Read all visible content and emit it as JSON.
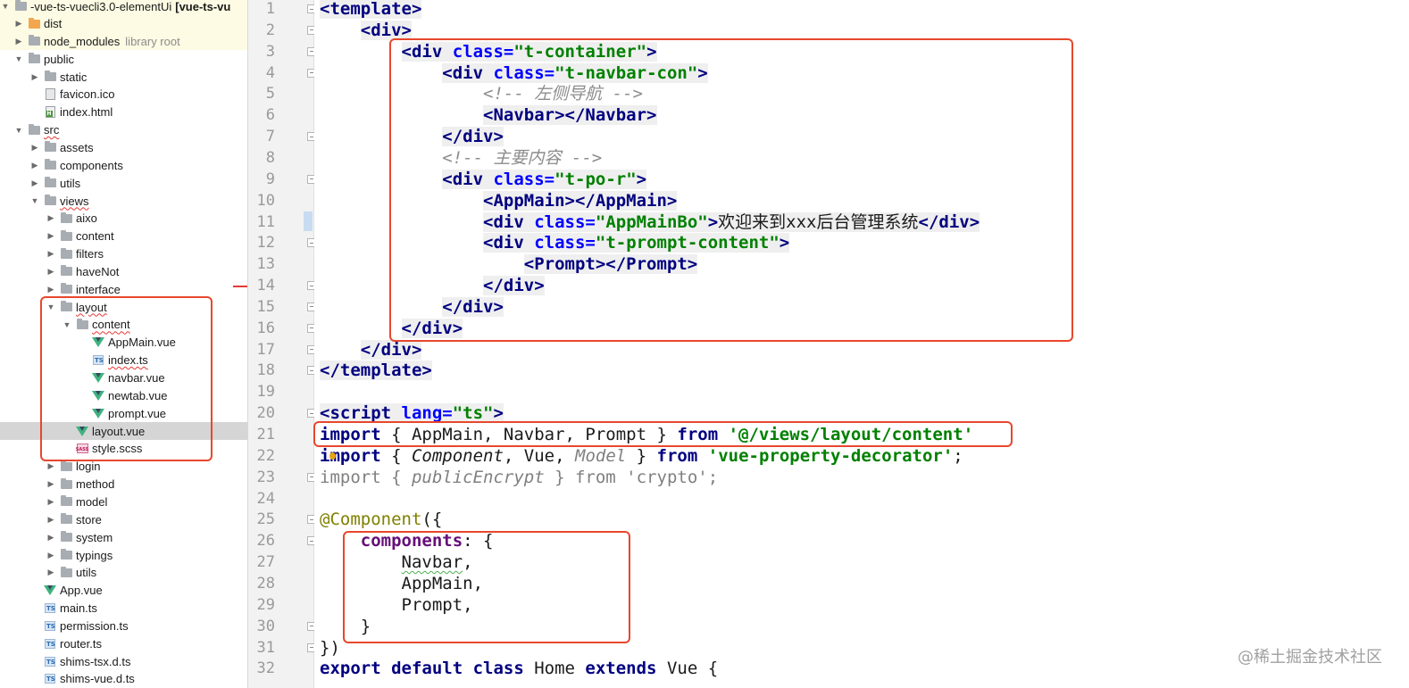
{
  "project": {
    "title": "-vue-ts-vuecli3.0-elementUi",
    "title_module": "[vue-ts-vu"
  },
  "tree": [
    {
      "label": "dist",
      "indent": 1,
      "arrow": "right",
      "icon": "folder-orange"
    },
    {
      "label": "node_modules",
      "extra": "library root",
      "indent": 1,
      "arrow": "right",
      "icon": "folder"
    },
    {
      "label": "public",
      "indent": 1,
      "arrow": "down",
      "icon": "folder"
    },
    {
      "label": "static",
      "indent": 2,
      "arrow": "right",
      "icon": "folder"
    },
    {
      "label": "favicon.ico",
      "indent": 2,
      "arrow": "",
      "icon": "ico"
    },
    {
      "label": "index.html",
      "indent": 2,
      "arrow": "",
      "icon": "html"
    },
    {
      "label": "src",
      "indent": 1,
      "arrow": "down",
      "icon": "folder",
      "wavy": true
    },
    {
      "label": "assets",
      "indent": 2,
      "arrow": "right",
      "icon": "folder"
    },
    {
      "label": "components",
      "indent": 2,
      "arrow": "right",
      "icon": "folder"
    },
    {
      "label": "utils",
      "indent": 2,
      "arrow": "right",
      "icon": "folder"
    },
    {
      "label": "views",
      "indent": 2,
      "arrow": "down",
      "icon": "folder",
      "wavy": true
    },
    {
      "label": "aixo",
      "indent": 3,
      "arrow": "right",
      "icon": "folder"
    },
    {
      "label": "content",
      "indent": 3,
      "arrow": "right",
      "icon": "folder"
    },
    {
      "label": "filters",
      "indent": 3,
      "arrow": "right",
      "icon": "folder"
    },
    {
      "label": "haveNot",
      "indent": 3,
      "arrow": "right",
      "icon": "folder"
    },
    {
      "label": "interface",
      "indent": 3,
      "arrow": "right",
      "icon": "folder"
    },
    {
      "label": "layout",
      "indent": 3,
      "arrow": "down",
      "icon": "folder",
      "wavy": true
    },
    {
      "label": "content",
      "indent": 4,
      "arrow": "down",
      "icon": "folder",
      "wavy": true
    },
    {
      "label": "AppMain.vue",
      "indent": 5,
      "arrow": "",
      "icon": "vue"
    },
    {
      "label": "index.ts",
      "indent": 5,
      "arrow": "",
      "icon": "ts",
      "wavy": true
    },
    {
      "label": "navbar.vue",
      "indent": 5,
      "arrow": "",
      "icon": "vue"
    },
    {
      "label": "newtab.vue",
      "indent": 5,
      "arrow": "",
      "icon": "vue"
    },
    {
      "label": "prompt.vue",
      "indent": 5,
      "arrow": "",
      "icon": "vue"
    },
    {
      "label": "layout.vue",
      "indent": 4,
      "arrow": "",
      "icon": "vue",
      "selected": true
    },
    {
      "label": "style.scss",
      "indent": 4,
      "arrow": "",
      "icon": "sass"
    },
    {
      "label": "login",
      "indent": 3,
      "arrow": "right",
      "icon": "folder"
    },
    {
      "label": "method",
      "indent": 3,
      "arrow": "right",
      "icon": "folder"
    },
    {
      "label": "model",
      "indent": 3,
      "arrow": "right",
      "icon": "folder"
    },
    {
      "label": "store",
      "indent": 3,
      "arrow": "right",
      "icon": "folder"
    },
    {
      "label": "system",
      "indent": 3,
      "arrow": "right",
      "icon": "folder"
    },
    {
      "label": "typings",
      "indent": 3,
      "arrow": "right",
      "icon": "folder"
    },
    {
      "label": "utils",
      "indent": 3,
      "arrow": "right",
      "icon": "folder"
    },
    {
      "label": "App.vue",
      "indent": 2,
      "arrow": "",
      "icon": "vue"
    },
    {
      "label": "main.ts",
      "indent": 2,
      "arrow": "",
      "icon": "ts"
    },
    {
      "label": "permission.ts",
      "indent": 2,
      "arrow": "",
      "icon": "ts"
    },
    {
      "label": "router.ts",
      "indent": 2,
      "arrow": "",
      "icon": "ts"
    },
    {
      "label": "shims-tsx.d.ts",
      "indent": 2,
      "arrow": "",
      "icon": "ts"
    },
    {
      "label": "shims-vue.d.ts",
      "indent": 2,
      "arrow": "",
      "icon": "ts"
    }
  ],
  "line_numbers": [
    "1",
    "2",
    "3",
    "4",
    "5",
    "6",
    "7",
    "8",
    "9",
    "10",
    "11",
    "12",
    "13",
    "14",
    "15",
    "16",
    "17",
    "18",
    "19",
    "20",
    "21",
    "22",
    "23",
    "24",
    "25",
    "26",
    "27",
    "28",
    "29",
    "30",
    "31",
    "32"
  ],
  "code": [
    [
      [
        "<template>",
        "tg tagbg"
      ]
    ],
    [
      [
        "    ",
        ""
      ],
      [
        "<div>",
        "tg tagbg"
      ]
    ],
    [
      [
        "        ",
        ""
      ],
      [
        "<div ",
        "tg tagbg"
      ],
      [
        "class=",
        "at tagbg"
      ],
      [
        "\"t-container\"",
        "sv tagbg"
      ],
      [
        ">",
        "tg tagbg"
      ]
    ],
    [
      [
        "            ",
        ""
      ],
      [
        "<div ",
        "tg tagbg"
      ],
      [
        "class=",
        "at tagbg"
      ],
      [
        "\"t-navbar-con\"",
        "sv tagbg"
      ],
      [
        ">",
        "tg tagbg"
      ]
    ],
    [
      [
        "                ",
        ""
      ],
      [
        "<!-- 左侧导航 -->",
        "cm"
      ]
    ],
    [
      [
        "                ",
        ""
      ],
      [
        "<Navbar></Navbar>",
        "tg tagbg"
      ]
    ],
    [
      [
        "            ",
        ""
      ],
      [
        "</div>",
        "tg tagbg"
      ]
    ],
    [
      [
        "            ",
        ""
      ],
      [
        "<!-- 主要内容 -->",
        "cm"
      ]
    ],
    [
      [
        "            ",
        ""
      ],
      [
        "<div ",
        "tg tagbg"
      ],
      [
        "class=",
        "at tagbg"
      ],
      [
        "\"t-po-r\"",
        "sv tagbg"
      ],
      [
        ">",
        "tg tagbg"
      ]
    ],
    [
      [
        "                ",
        ""
      ],
      [
        "<AppMain></AppMain>",
        "tg tagbg"
      ]
    ],
    [
      [
        "                ",
        ""
      ],
      [
        "<div ",
        "tg tagbg"
      ],
      [
        "class=",
        "at tagbg"
      ],
      [
        "\"AppMainBo\"",
        "sv tagbg"
      ],
      [
        ">",
        "tg tagbg"
      ],
      [
        "欢迎来到xxx后台管理系统",
        "tagbg"
      ],
      [
        "</div>",
        "tg tagbg"
      ]
    ],
    [
      [
        "                ",
        ""
      ],
      [
        "<div ",
        "tg tagbg"
      ],
      [
        "class=",
        "at tagbg"
      ],
      [
        "\"t-prompt-content\"",
        "sv tagbg"
      ],
      [
        ">",
        "tg tagbg"
      ]
    ],
    [
      [
        "                    ",
        ""
      ],
      [
        "<Prompt></Prompt>",
        "tg tagbg"
      ]
    ],
    [
      [
        "                ",
        ""
      ],
      [
        "</div>",
        "tg tagbg"
      ]
    ],
    [
      [
        "            ",
        ""
      ],
      [
        "</div>",
        "tg tagbg"
      ]
    ],
    [
      [
        "        ",
        ""
      ],
      [
        "</div>",
        "tg tagbg"
      ]
    ],
    [
      [
        "    ",
        ""
      ],
      [
        "</div>",
        "tg tagbg"
      ]
    ],
    [
      [
        "</template>",
        "tg tagbg"
      ]
    ],
    [
      [
        "",
        ""
      ]
    ],
    [
      [
        "<script ",
        "tg tagbg"
      ],
      [
        "lang=",
        "at tagbg"
      ],
      [
        "\"ts\"",
        "sv tagbg"
      ],
      [
        ">",
        "tg tagbg"
      ]
    ],
    [
      [
        "import",
        "kw"
      ],
      [
        " { AppMain, Navbar, Prompt } ",
        ""
      ],
      [
        "from",
        "kw"
      ],
      [
        " ",
        ""
      ],
      [
        "'@/views/layout/content'",
        "sv"
      ]
    ],
    [
      [
        "import",
        "kw"
      ],
      [
        " { ",
        ""
      ],
      [
        "Component",
        "it"
      ],
      [
        ", Vue, ",
        ""
      ],
      [
        "Model",
        "it gr"
      ],
      [
        " } ",
        ""
      ],
      [
        "from",
        "kw"
      ],
      [
        " ",
        ""
      ],
      [
        "'vue-property-decorator'",
        "sv"
      ],
      [
        ";",
        ""
      ]
    ],
    [
      [
        "import { ",
        "gr"
      ],
      [
        "publicEncrypt",
        "gr it"
      ],
      [
        " } from 'crypto';",
        "gr"
      ]
    ],
    [
      [
        "",
        ""
      ]
    ],
    [
      [
        "@Component",
        "an"
      ],
      [
        "({",
        ""
      ]
    ],
    [
      [
        "    ",
        ""
      ],
      [
        "components",
        "pp"
      ],
      [
        ": {",
        ""
      ]
    ],
    [
      [
        "        ",
        ""
      ],
      [
        "Navbar",
        "wv"
      ],
      [
        ",",
        ""
      ]
    ],
    [
      [
        "        AppMain,",
        ""
      ]
    ],
    [
      [
        "        Prompt,",
        ""
      ]
    ],
    [
      [
        "    }",
        ""
      ]
    ],
    [
      [
        "})",
        ""
      ]
    ],
    [
      [
        "export default class ",
        "kw"
      ],
      [
        "Home ",
        ""
      ],
      [
        "extends ",
        "kw"
      ],
      [
        "Vue {",
        ""
      ]
    ]
  ],
  "watermark": "@稀土掘金技术社区"
}
